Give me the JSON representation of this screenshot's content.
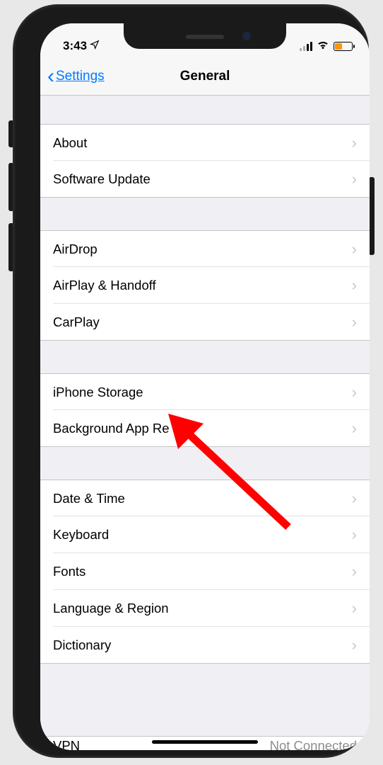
{
  "status": {
    "time": "3:43",
    "location_icon": "location-arrow-icon"
  },
  "nav": {
    "back_label": "Settings",
    "title": "General"
  },
  "groups": [
    {
      "rows": [
        {
          "name": "about-row",
          "label": "About"
        },
        {
          "name": "software-update-row",
          "label": "Software Update"
        }
      ]
    },
    {
      "rows": [
        {
          "name": "airdrop-row",
          "label": "AirDrop"
        },
        {
          "name": "airplay-handoff-row",
          "label": "AirPlay & Handoff"
        },
        {
          "name": "carplay-row",
          "label": "CarPlay"
        }
      ]
    },
    {
      "rows": [
        {
          "name": "iphone-storage-row",
          "label": "iPhone Storage"
        },
        {
          "name": "background-app-refresh-row",
          "label": "Background App Re"
        }
      ]
    },
    {
      "rows": [
        {
          "name": "date-time-row",
          "label": "Date & Time"
        },
        {
          "name": "keyboard-row",
          "label": "Keyboard"
        },
        {
          "name": "fonts-row",
          "label": "Fonts"
        },
        {
          "name": "language-region-row",
          "label": "Language & Region"
        },
        {
          "name": "dictionary-row",
          "label": "Dictionary"
        }
      ]
    }
  ],
  "cutoff": {
    "label": "VPN",
    "value": "Not Connected"
  }
}
